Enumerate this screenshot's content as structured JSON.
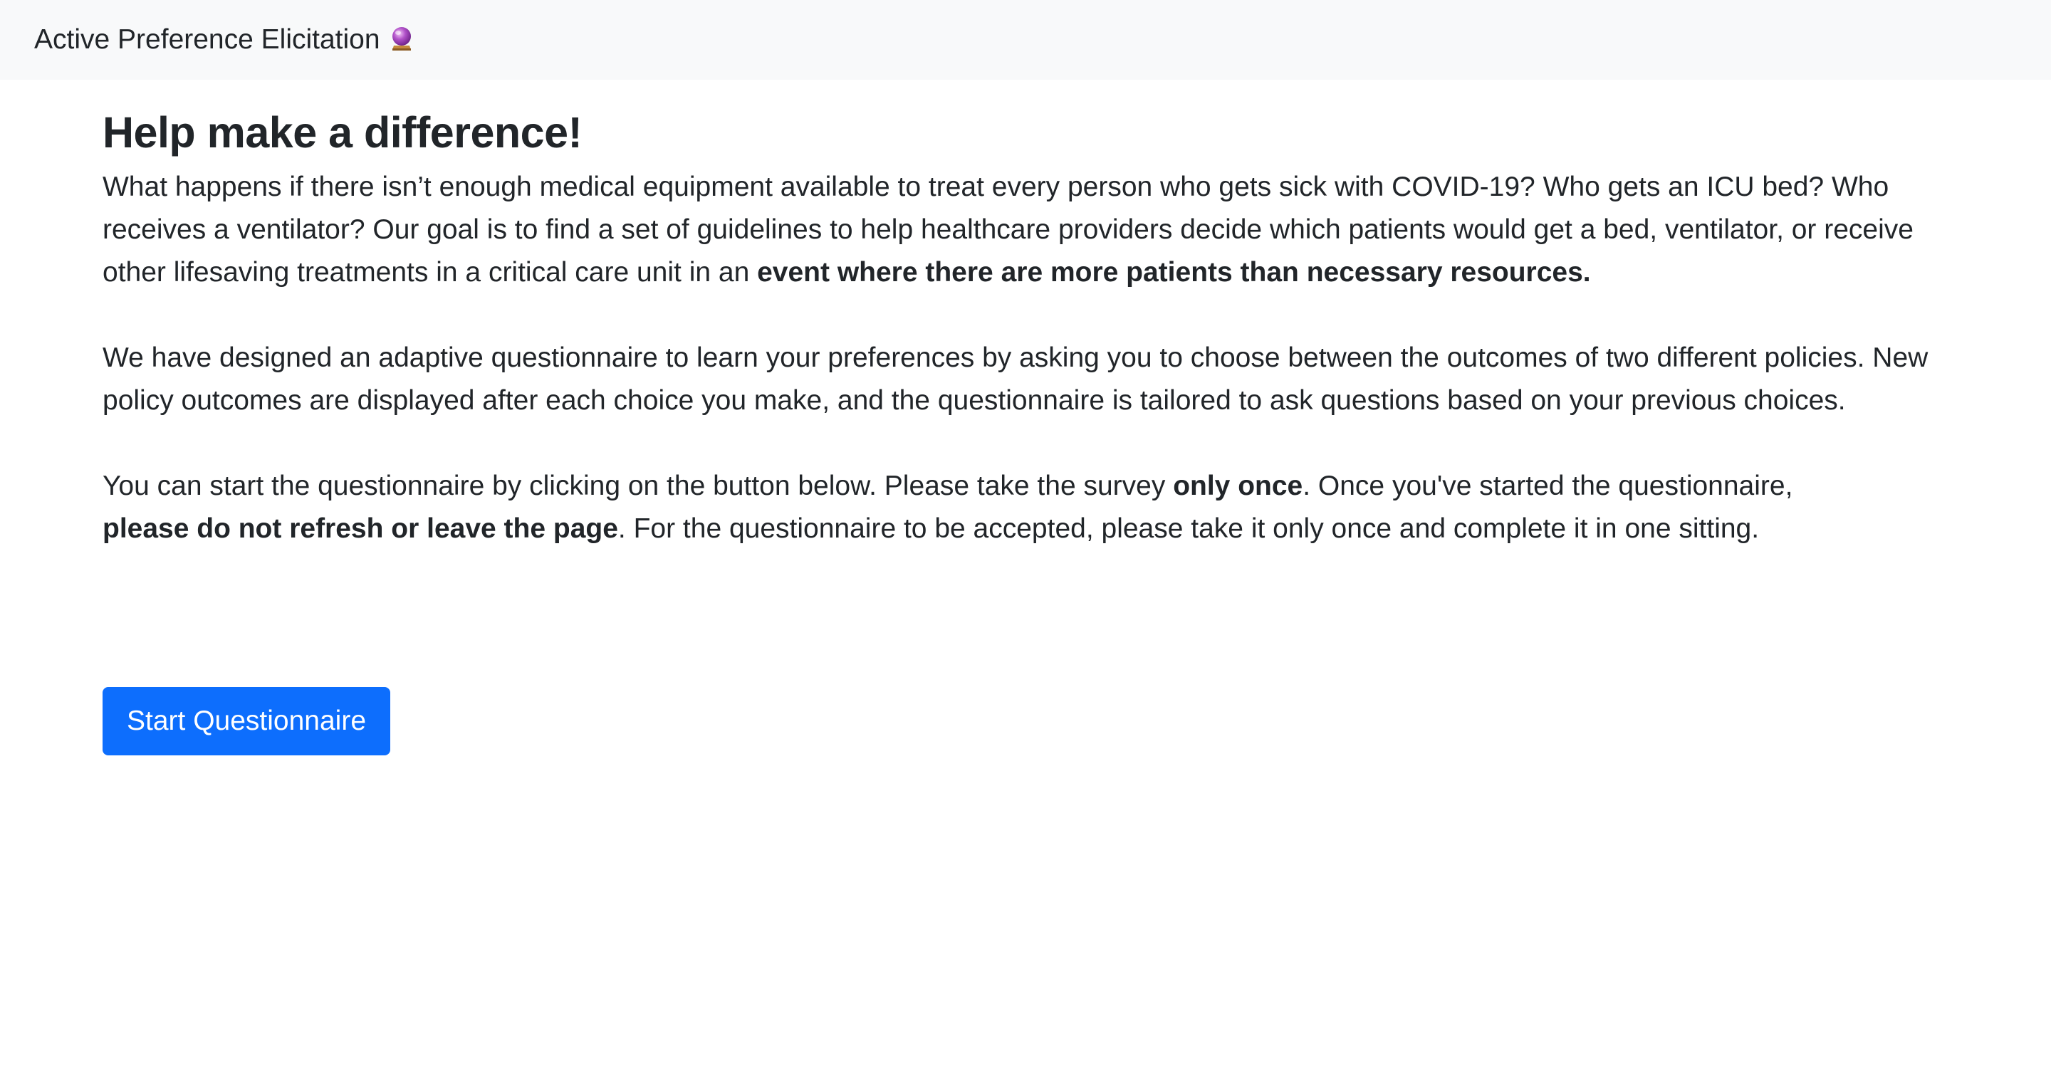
{
  "navbar": {
    "brand": "Active Preference Elicitation",
    "brand_icon": "crystal-ball-icon"
  },
  "main": {
    "heading": "Help make a difference!",
    "intro": {
      "text": "What happens if there isn’t enough medical equipment available to treat every person who gets sick with COVID-19? Who gets an ICU bed? Who receives a ventilator? Our goal is to find a set of guidelines to help healthcare providers decide which patients would get a bed, ventilator, or receive other lifesaving treatments in a critical care unit in an ",
      "bold": "event where there are more patients than necessary resources."
    },
    "design": {
      "text": "We have designed an adaptive questionnaire to learn your preferences by asking you to choose between the outcomes of two different policies. New policy outcomes are displayed after each choice you make, and the questionnaire is tailored to ask questions based on your previous choices."
    },
    "instructions": {
      "part1": "You can start the questionnaire by clicking on the button below. Please take the survey ",
      "bold1": "only once",
      "part2": ". Once you've started the questionnaire, ",
      "bold2": "please do not refresh or leave the page",
      "part3": ". For the questionnaire to be accepted, please take it only once and complete it in one sitting."
    },
    "start_button": "Start Questionnaire"
  },
  "colors": {
    "navbar_bg": "#f8f9fa",
    "text": "#212529",
    "primary": "#0d6efd"
  }
}
